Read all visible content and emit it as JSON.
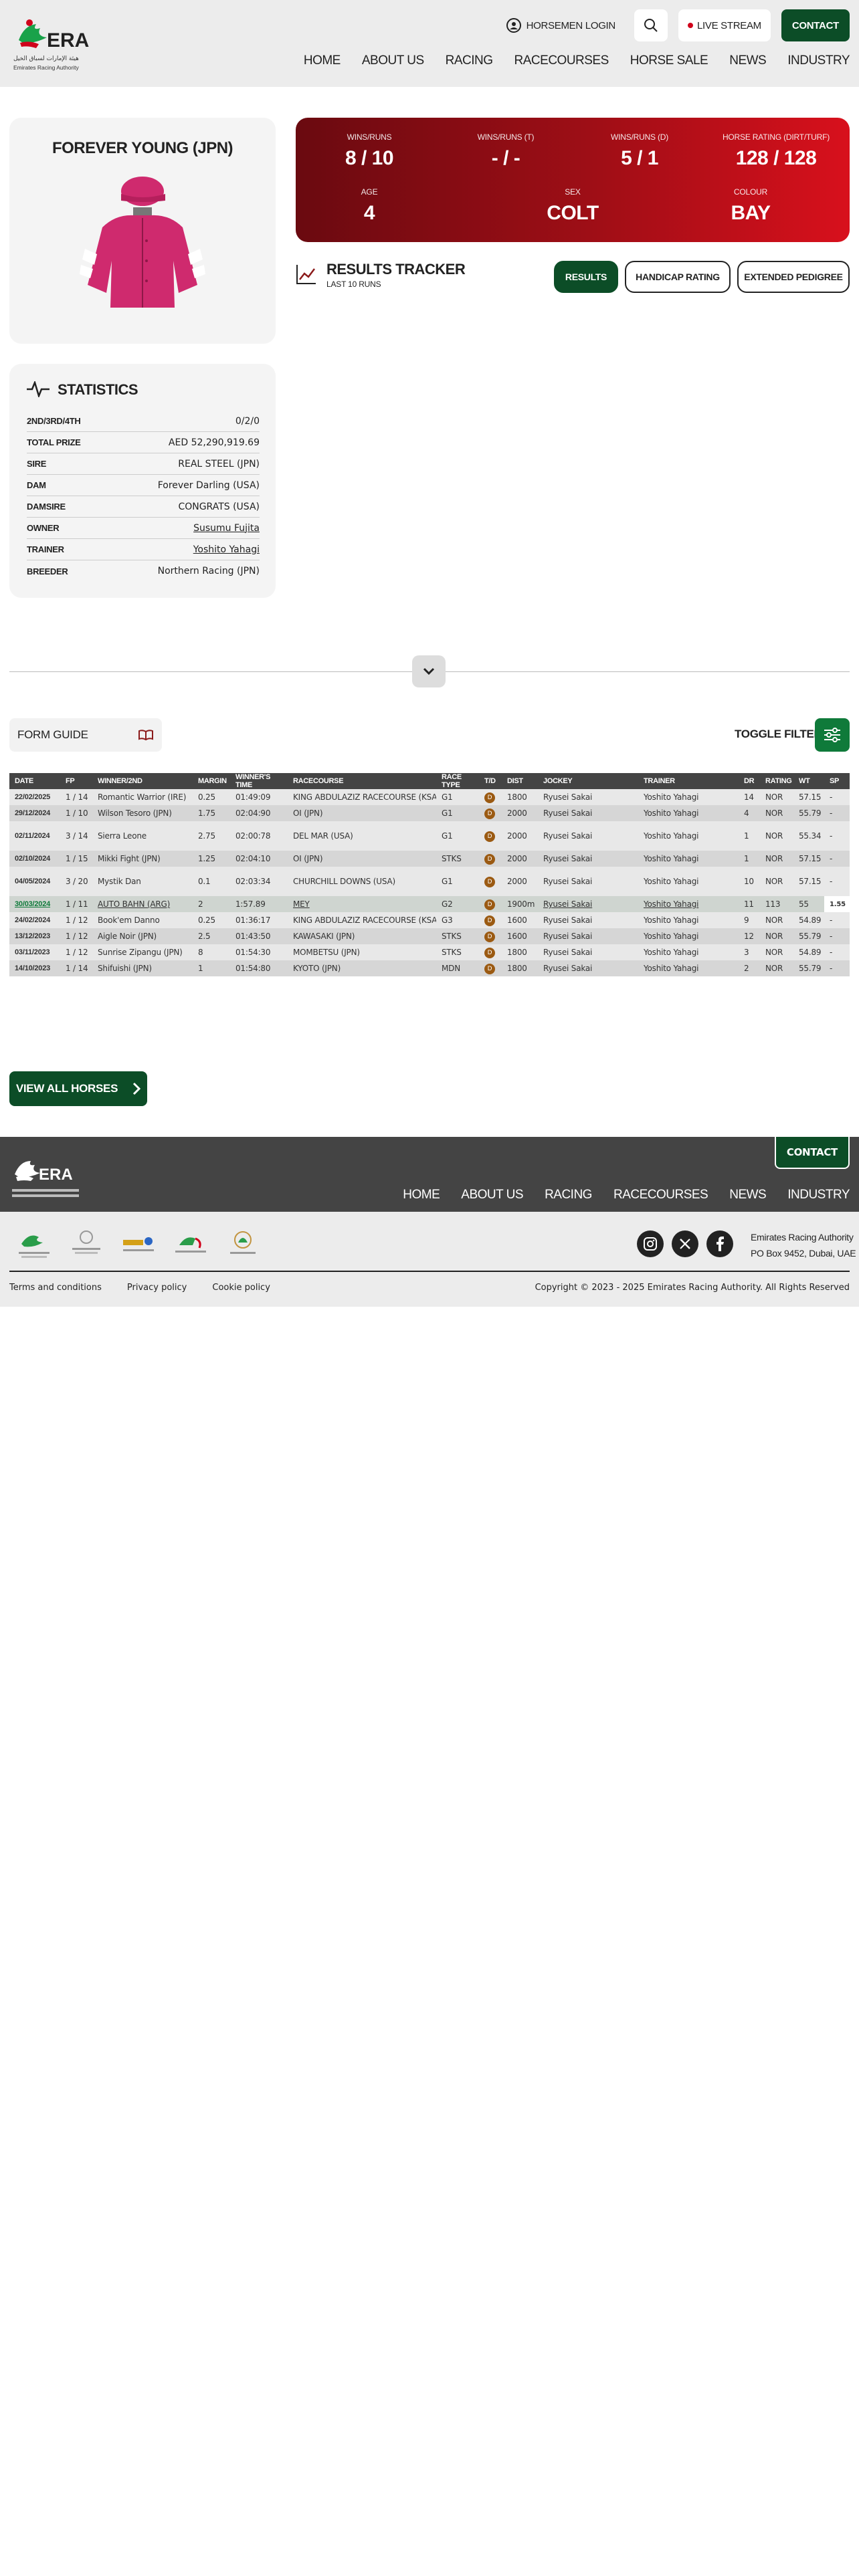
{
  "header": {
    "logo_en": "Emirates Racing Authority",
    "logo_ar": "هيئة الإمارات لسباق الخيل",
    "logo_abbr": "ERA",
    "horsemen_login": "HORSEMEN LOGIN",
    "live_stream": "LIVE STREAM",
    "contact": "CONTACT",
    "nav": [
      "HOME",
      "ABOUT US",
      "RACING",
      "RACECOURSES",
      "HORSE SALE",
      "NEWS",
      "INDUSTRY"
    ]
  },
  "horse": {
    "name": "FOREVER YOUNG (JPN)",
    "silks_colors": {
      "primary": "#cf2a6e",
      "sleeve_stripe": "#ffffff",
      "cap": "#cf2a6e"
    }
  },
  "stats_box": {
    "cells": [
      {
        "label": "WINS/RUNS",
        "value": "8 / 10"
      },
      {
        "label": "WINS/RUNS (T)",
        "value": "- / -"
      },
      {
        "label": "WINS/RUNS (D)",
        "value": "5 / 1"
      },
      {
        "label": "HORSE RATING (DIRT/TURF)",
        "value": "128 / 128"
      },
      {
        "label": "AGE",
        "value": "4"
      },
      {
        "label": "SEX",
        "value": "COLT"
      },
      {
        "label": "COLOUR",
        "value": "BAY"
      }
    ]
  },
  "results_tracker": {
    "title": "RESULTS TRACKER",
    "subtitle": "LAST 10 RUNS",
    "buttons": [
      "RESULTS",
      "HANDICAP RATING",
      "EXTENDED PEDIGREE"
    ]
  },
  "statistics": {
    "title": "STATISTICS",
    "rows": [
      {
        "key": "2ND/3RD/4TH",
        "value": "0/2/0"
      },
      {
        "key": "TOTAL PRIZE",
        "value": "AED 52,290,919.69"
      },
      {
        "key": "SIRE",
        "value": "REAL STEEL (JPN)"
      },
      {
        "key": "DAM",
        "value": "Forever Darling (USA)"
      },
      {
        "key": "DAMSIRE",
        "value": "CONGRATS (USA)"
      },
      {
        "key": "OWNER",
        "value": "Susumu Fujita"
      },
      {
        "key": "TRAINER",
        "value": "Yoshito Yahagi"
      },
      {
        "key": "BREEDER",
        "value": "Northern Racing (JPN)"
      }
    ]
  },
  "form_guide": {
    "label": "FORM GUIDE",
    "toggle_filter": "TOGGLE FILTER",
    "columns": [
      "DATE",
      "FP",
      "WINNER/2ND",
      "MARGIN",
      "WINNER'S TIME",
      "RACECOURSE",
      "RACE TYPE",
      "T/D",
      "DIST",
      "JOCKEY",
      "TRAINER",
      "DR",
      "RATING",
      "WT",
      "SP"
    ],
    "rows": [
      [
        "22/02/2025",
        "1 / 14",
        "Romantic Warrior (IRE)",
        "0.25",
        "01:49:09",
        "KING ABDULAZIZ RACECOURSE (KSA)",
        "G1",
        "D",
        "1800",
        "Ryusei Sakai",
        "Yoshito Yahagi",
        "14",
        "NOR",
        "57.15",
        "-"
      ],
      [
        "29/12/2024",
        "1 / 10",
        "Wilson Tesoro (JPN)",
        "1.75",
        "02:04:90",
        "OI (JPN)",
        "G1",
        "D",
        "2000",
        "Ryusei Sakai",
        "Yoshito Yahagi",
        "4",
        "NOR",
        "55.79",
        "-"
      ],
      [
        "02/11/2024",
        "3 / 14",
        "Sierra Leone",
        "2.75",
        "02:00:78",
        "DEL MAR (USA)",
        "G1",
        "D",
        "2000",
        "Ryusei Sakai",
        "Yoshito Yahagi",
        "1",
        "NOR",
        "55.34",
        "-"
      ],
      [
        "02/10/2024",
        "1 / 15",
        "Mikki Fight (JPN)",
        "1.25",
        "02:04:10",
        "OI (JPN)",
        "STKS",
        "D",
        "2000",
        "Ryusei Sakai",
        "Yoshito Yahagi",
        "1",
        "NOR",
        "57.15",
        "-"
      ],
      [
        "04/05/2024",
        "3 / 20",
        "Mystik Dan",
        "0.1",
        "02:03:34",
        "CHURCHILL DOWNS (USA)",
        "G1",
        "D",
        "2000",
        "Ryusei Sakai",
        "Yoshito Yahagi",
        "10",
        "NOR",
        "57.15",
        "-"
      ],
      [
        "30/03/2024",
        "1 / 11",
        "AUTO BAHN (ARG)",
        "2",
        "1:57.89",
        "MEY",
        "G2",
        "D",
        "1900m",
        "Ryusei Sakai",
        "Yoshito Yahagi",
        "11",
        "113",
        "55",
        "1.55"
      ],
      [
        "24/02/2024",
        "1 / 12",
        "Book'em Danno",
        "0.25",
        "01:36:17",
        "KING ABDULAZIZ RACECOURSE (KSA)",
        "G3",
        "D",
        "1600",
        "Ryusei Sakai",
        "Yoshito Yahagi",
        "9",
        "NOR",
        "54.89",
        "-"
      ],
      [
        "13/12/2023",
        "1 / 12",
        "Aigle Noir (JPN)",
        "2.5",
        "01:43:50",
        "KAWASAKI (JPN)",
        "STKS",
        "D",
        "1600",
        "Ryusei Sakai",
        "Yoshito Yahagi",
        "12",
        "NOR",
        "55.79",
        "-"
      ],
      [
        "03/11/2023",
        "1 / 12",
        "Sunrise Zipangu (JPN)",
        "8",
        "01:54:30",
        "MOMBETSU (JPN)",
        "STKS",
        "D",
        "1800",
        "Ryusei Sakai",
        "Yoshito Yahagi",
        "3",
        "NOR",
        "54.89",
        "-"
      ],
      [
        "14/10/2023",
        "1 / 14",
        "Shifuishi (JPN)",
        "1",
        "01:54:80",
        "KYOTO (JPN)",
        "MDN",
        "D",
        "1800",
        "Ryusei Sakai",
        "Yoshito Yahagi",
        "2",
        "NOR",
        "55.79",
        "-"
      ]
    ]
  },
  "view_all": "VIEW ALL HORSES",
  "footer": {
    "contact": "CONTACT",
    "nav": [
      "HOME",
      "ABOUT US",
      "RACING",
      "RACECOURSES",
      "NEWS",
      "INDUSTRY"
    ],
    "address_line1": "Emirates Racing Authority",
    "address_line2": "PO Box 9452, Dubai, UAE",
    "links": [
      "Terms and conditions",
      "Privacy policy",
      "Cookie policy"
    ],
    "copyright": "Copyright © 2023 - 2025 Emirates Racing Authority. All Rights Reserved",
    "social": [
      "instagram-icon",
      "x-icon",
      "facebook-icon"
    ],
    "partner_logos": 5
  },
  "colors": {
    "brand_green": "#0c4d27",
    "stat_red_dark": "#6a0a10",
    "stat_red_light": "#d8101c",
    "header_grey": "#ececec",
    "footer_dark": "#444444"
  }
}
